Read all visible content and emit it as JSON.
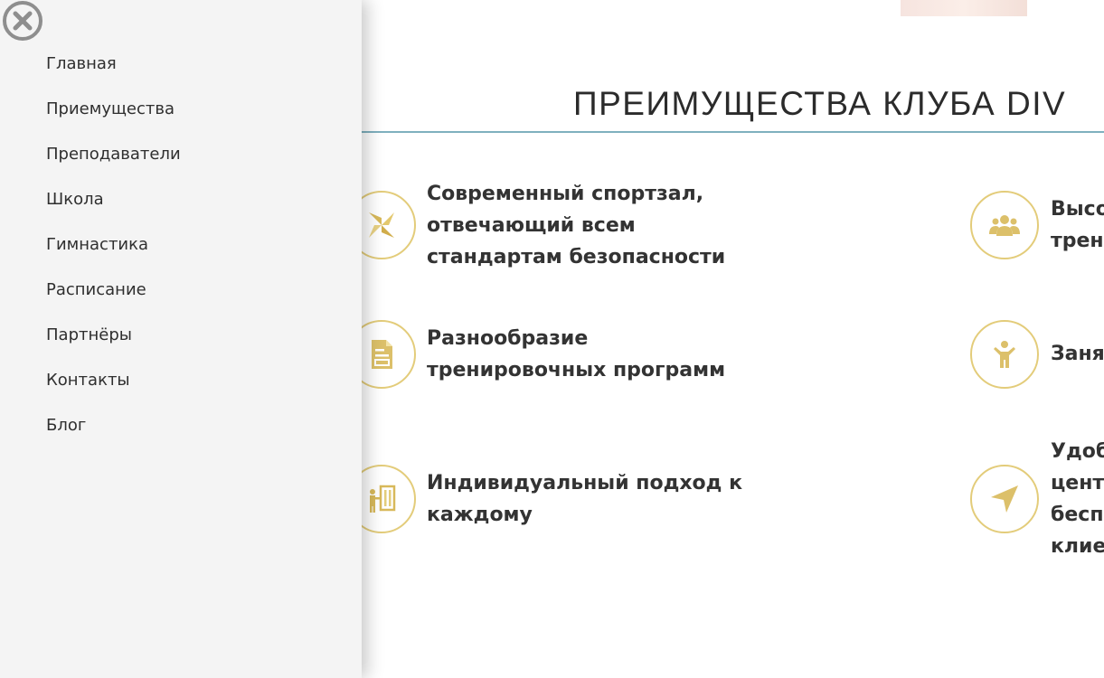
{
  "drawer": {
    "close_icon": "close-circle-icon",
    "items": [
      {
        "label": "Главная"
      },
      {
        "label": "Приемущества"
      },
      {
        "label": "Преподаватели"
      },
      {
        "label": "Школа"
      },
      {
        "label": "Гимнастика"
      },
      {
        "label": "Расписание"
      },
      {
        "label": "Партнёры"
      },
      {
        "label": "Контакты"
      },
      {
        "label": "Блог"
      }
    ]
  },
  "section": {
    "title": "ПРЕИМУЩЕСТВА КЛУБА DIV",
    "accent_color": "#e3cc7a",
    "underline_color": "#7fb0be"
  },
  "features": [
    {
      "icon": "pinwheel-icon",
      "text": "Современный спортзал,\nотвечающий всем\nстандартам безопасности"
    },
    {
      "icon": "document-icon",
      "text": "Разнообразие\nтренировочных программ"
    },
    {
      "icon": "trainer-board-icon",
      "text": "Индивидуальный подход к\nкаждому"
    },
    {
      "icon": "group-icon",
      "text": "Высо\nтрен"
    },
    {
      "icon": "child-icon",
      "text": "Заня"
    },
    {
      "icon": "navigation-arrow-icon",
      "text": "Удоб\nцент\nбесп\nклие"
    }
  ]
}
